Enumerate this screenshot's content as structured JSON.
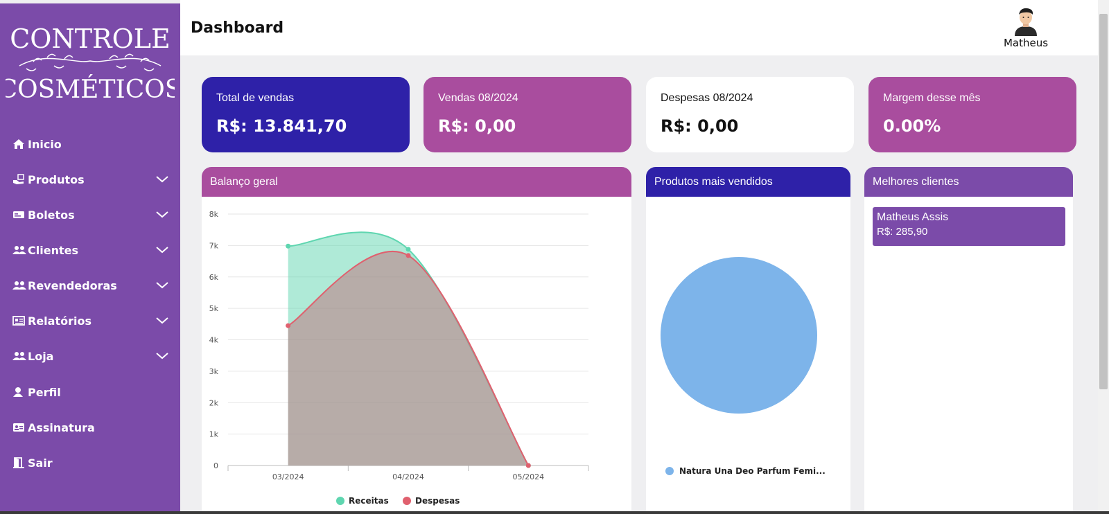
{
  "app": {
    "logo_text_top": "CONTROLE",
    "logo_text_bottom": "COSMÉTICOS"
  },
  "sidebar": {
    "items": [
      {
        "label": "Inicio",
        "icon": "home-icon",
        "has_submenu": false
      },
      {
        "label": "Produtos",
        "icon": "products-hand-icon",
        "has_submenu": true
      },
      {
        "label": "Boletos",
        "icon": "money-bill-icon",
        "has_submenu": true
      },
      {
        "label": "Clientes",
        "icon": "users-icon",
        "has_submenu": true
      },
      {
        "label": "Revendedoras",
        "icon": "users-icon",
        "has_submenu": true
      },
      {
        "label": "Relatórios",
        "icon": "newspaper-icon",
        "has_submenu": true
      },
      {
        "label": "Loja",
        "icon": "users-icon",
        "has_submenu": true
      },
      {
        "label": "Perfil",
        "icon": "user-icon",
        "has_submenu": false
      },
      {
        "label": "Assinatura",
        "icon": "id-card-icon",
        "has_submenu": false
      },
      {
        "label": "Sair",
        "icon": "door-exit-icon",
        "has_submenu": false
      }
    ]
  },
  "header": {
    "title": "Dashboard",
    "user_name": "Matheus"
  },
  "cards": [
    {
      "label": "Total de vendas",
      "value": "R$: 13.841,70",
      "bg": "#2e21a8",
      "fg": "#ffffff"
    },
    {
      "label": "Vendas 08/2024",
      "value": "R$: 0,00",
      "bg": "#a94d9e",
      "fg": "#ffffff"
    },
    {
      "label": "Despesas 08/2024",
      "value": "R$: 0,00",
      "bg": "#ffffff",
      "fg": "#111111"
    },
    {
      "label": "Margem desse mês",
      "value": "0.00%",
      "bg": "#a94d9e",
      "fg": "#ffffff"
    }
  ],
  "panels": {
    "balance": {
      "title": "Balanço geral",
      "color": "#a94d9e"
    },
    "top_products": {
      "title": "Produtos mais vendidos",
      "color": "#2e21a8"
    },
    "top_clients": {
      "title": "Melhores clientes",
      "color": "#7b4ba9"
    }
  },
  "top_clients": [
    {
      "name": "Matheus Assis",
      "amount": "R$: 285,90"
    }
  ],
  "chart_data": [
    {
      "type": "area",
      "categories": [
        "03/2024",
        "04/2024",
        "05/2024"
      ],
      "series": [
        {
          "name": "Receitas",
          "values": [
            6980,
            6880,
            0
          ],
          "color": "#5fd6b0"
        },
        {
          "name": "Despesas",
          "values": [
            4450,
            6680,
            0
          ],
          "color": "#e0606e"
        }
      ],
      "ylim": [
        0,
        8000
      ],
      "yticks": [
        "0",
        "1k",
        "2k",
        "3k",
        "4k",
        "5k",
        "6k",
        "7k",
        "8k"
      ],
      "grid": true,
      "legend": "bottom"
    },
    {
      "type": "pie",
      "labels": [
        "Natura Una Deo Parfum Femi..."
      ],
      "values": [
        1
      ],
      "colors": [
        "#7db4ea"
      ],
      "legend": "bottom"
    }
  ]
}
